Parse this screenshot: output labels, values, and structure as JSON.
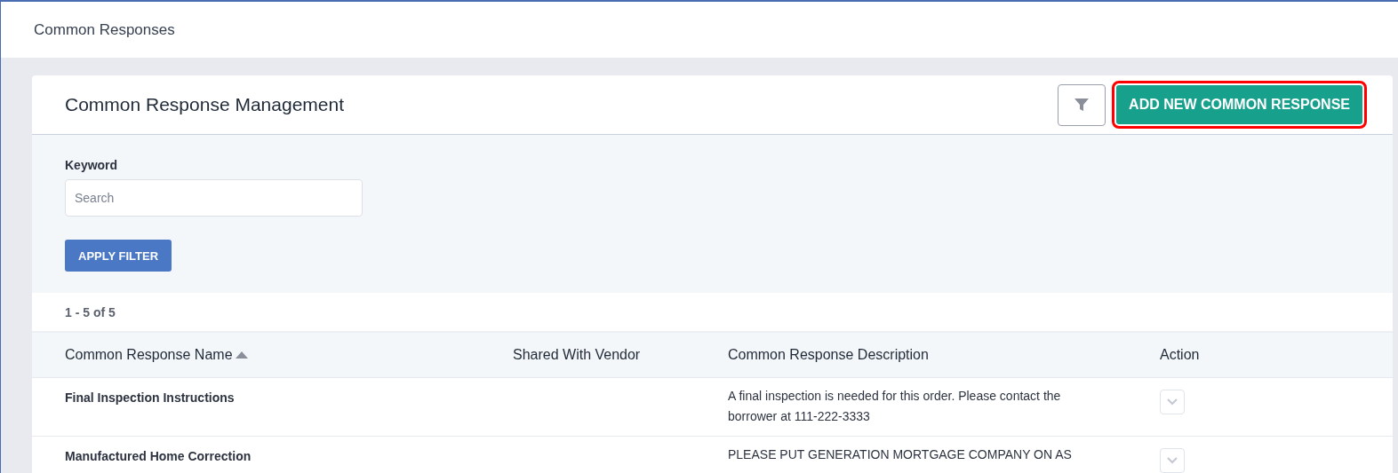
{
  "page_title": "Common Responses",
  "card": {
    "title": "Common Response Management",
    "add_button": {
      "label": "ADD NEW COMMON RESPONSE",
      "highlighted": true
    },
    "filter": {
      "label": "Keyword",
      "placeholder": "Search",
      "apply_label": "APPLY FILTER"
    },
    "count": "1 - 5 of 5",
    "table": {
      "columns": [
        {
          "label": "Common Response Name",
          "sorted": true
        },
        {
          "label": "Shared With Vendor",
          "sorted": false
        },
        {
          "label": "Common Response Description",
          "sorted": false
        },
        {
          "label": "Action",
          "sorted": false
        }
      ],
      "rows": [
        {
          "name": "Final Inspection Instructions",
          "shared": "",
          "description": "A final inspection is needed for this order. Please contact the borrower at 111-222-3333"
        },
        {
          "name": "Manufactured Home Correction",
          "shared": "",
          "description": "PLEASE PUT GENERATION MORTGAGE COMPANY ON AS"
        }
      ]
    }
  }
}
